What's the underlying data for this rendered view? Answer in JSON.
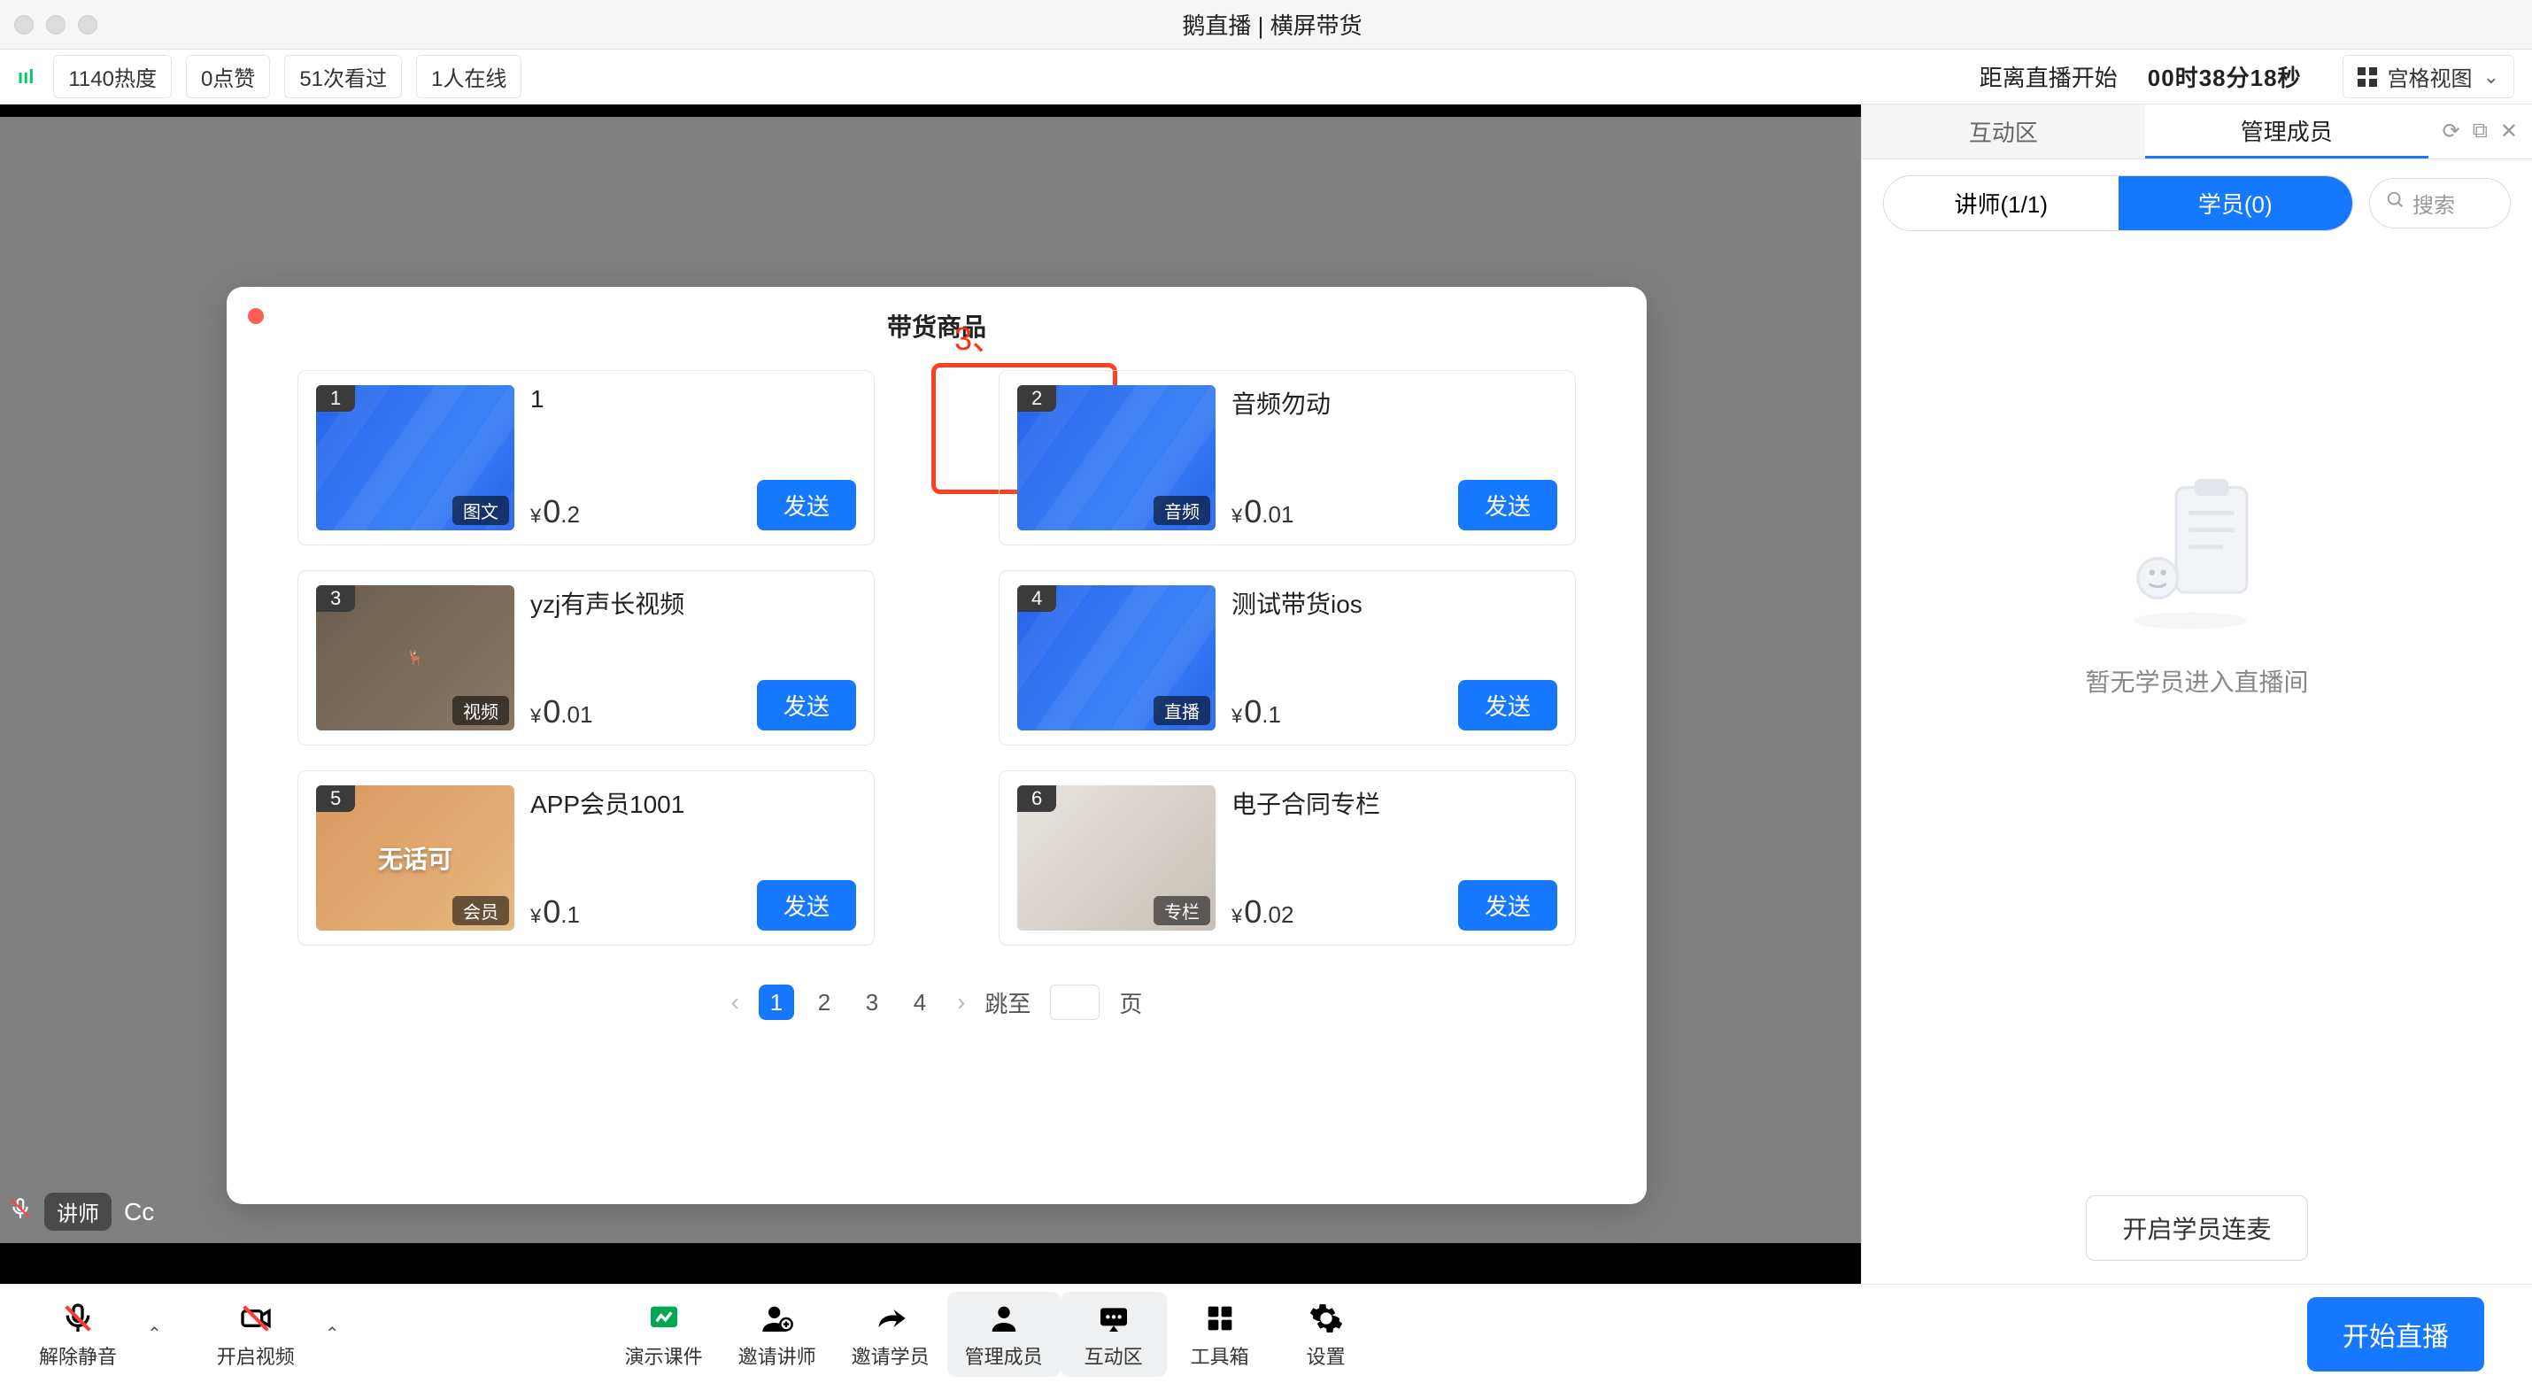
{
  "titlebar": {
    "title": "鹅直播 | 横屏带货"
  },
  "stats": {
    "heat": "1140热度",
    "like": "0点赞",
    "watched": "51次看过",
    "online": "1人在线",
    "countdown_label": "距离直播开始",
    "countdown_time": "00时38分18秒",
    "view_mode": "宫格视图"
  },
  "modal": {
    "title": "带货商品",
    "annotation": "3、",
    "products": [
      {
        "num": "1",
        "tag": "图文",
        "title": "1",
        "price_int": "0",
        "price_dec": ".2",
        "btn": "发送",
        "thumb": "blue"
      },
      {
        "num": "2",
        "tag": "音频",
        "title": "音频勿动",
        "price_int": "0",
        "price_dec": ".01",
        "btn": "发送",
        "thumb": "blue"
      },
      {
        "num": "3",
        "tag": "视频",
        "title": "yzj有声长视频",
        "price_int": "0",
        "price_dec": ".01",
        "btn": "发送",
        "thumb": "deer"
      },
      {
        "num": "4",
        "tag": "直播",
        "title": "测试带货ios",
        "price_int": "0",
        "price_dec": ".1",
        "btn": "发送",
        "thumb": "blue"
      },
      {
        "num": "5",
        "tag": "会员",
        "title": "APP会员1001",
        "price_int": "0",
        "price_dec": ".1",
        "btn": "发送",
        "thumb": "cat"
      },
      {
        "num": "6",
        "tag": "专栏",
        "title": "电子合同专栏",
        "price_int": "0",
        "price_dec": ".02",
        "btn": "发送",
        "thumb": "wed"
      }
    ],
    "pagination": {
      "pages": [
        "1",
        "2",
        "3",
        "4"
      ],
      "jump_label_pre": "跳至",
      "jump_label_post": "页"
    }
  },
  "overlay": {
    "role": "讲师",
    "cc": "Cc"
  },
  "rightpanel": {
    "tab_interact": "互动区",
    "tab_manage": "管理成员",
    "seg_teacher": "讲师(1/1)",
    "seg_student": "学员(0)",
    "search_placeholder": "搜索",
    "empty_text": "暂无学员进入直播间",
    "connect_btn": "开启学员连麦"
  },
  "toolbar": {
    "unmute": "解除静音",
    "video": "开启视频",
    "courseware": "演示课件",
    "invite_teacher": "邀请讲师",
    "invite_student": "邀请学员",
    "manage": "管理成员",
    "interact": "互动区",
    "toolbox": "工具箱",
    "settings": "设置",
    "start": "开始直播"
  }
}
